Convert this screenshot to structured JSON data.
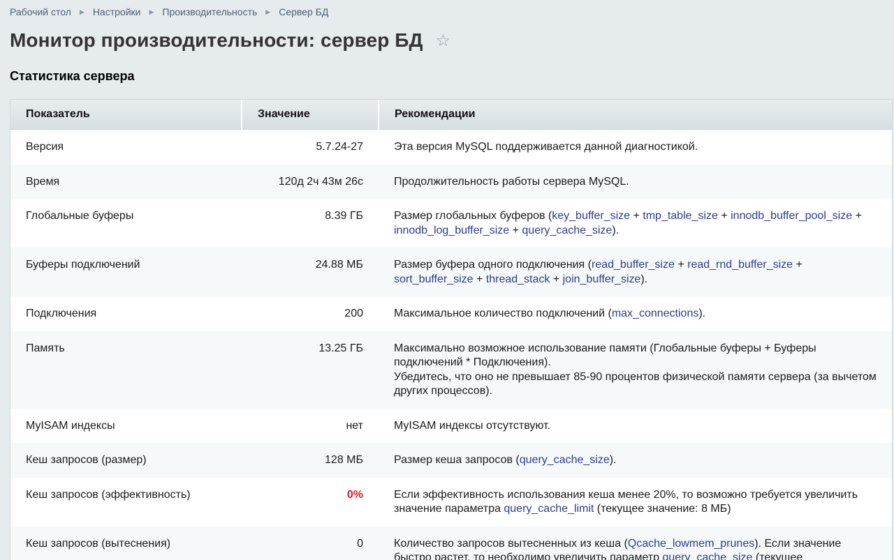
{
  "breadcrumb": {
    "items": [
      "Рабочий стол",
      "Настройки",
      "Производительность",
      "Сервер БД"
    ]
  },
  "page": {
    "title": "Монитор производительности: сервер БД",
    "section_title": "Статистика сервера"
  },
  "icons": {
    "favorite": "star-icon",
    "separator": "triangle-right-icon"
  },
  "colors": {
    "background": "#e6ebee",
    "link": "#2c3c8f",
    "warning": "#e01b1b",
    "row_alt": "#f5f9f9"
  },
  "table": {
    "headers": {
      "metric": "Показатель",
      "value": "Значение",
      "recommendation": "Рекомендации"
    },
    "rows": [
      {
        "metric": "Версия",
        "value": "5.7.24-27",
        "rec": [
          {
            "t": "Эта версия MySQL поддерживается данной диагностикой."
          }
        ]
      },
      {
        "metric": "Время",
        "value": "120д 2ч 43м 26с",
        "rec": [
          {
            "t": "Продолжительность работы сервера MySQL."
          }
        ]
      },
      {
        "metric": "Глобальные буферы",
        "value": "8.39 ГБ",
        "rec": [
          {
            "t": "Размер глобальных буферов ("
          },
          {
            "t": "key_buffer_size",
            "link": true
          },
          {
            "t": " + "
          },
          {
            "t": "tmp_table_size",
            "link": true
          },
          {
            "t": " + "
          },
          {
            "t": "innodb_buffer_pool_size",
            "link": true
          },
          {
            "t": " + "
          },
          {
            "t": "innodb_log_buffer_size",
            "link": true
          },
          {
            "t": " + "
          },
          {
            "t": "query_cache_size",
            "link": true
          },
          {
            "t": ")."
          }
        ]
      },
      {
        "metric": "Буферы подключений",
        "value": "24.88 МБ",
        "rec": [
          {
            "t": "Размер буфера одного подключения ("
          },
          {
            "t": "read_buffer_size",
            "link": true
          },
          {
            "t": " + "
          },
          {
            "t": "read_rnd_buffer_size",
            "link": true
          },
          {
            "t": " + "
          },
          {
            "t": "sort_buffer_size",
            "link": true
          },
          {
            "t": " + "
          },
          {
            "t": "thread_stack",
            "link": true
          },
          {
            "t": " + "
          },
          {
            "t": "join_buffer_size",
            "link": true
          },
          {
            "t": ")."
          }
        ]
      },
      {
        "metric": "Подключения",
        "value": "200",
        "rec": [
          {
            "t": "Максимальное количество подключений ("
          },
          {
            "t": "max_connections",
            "link": true
          },
          {
            "t": ")."
          }
        ]
      },
      {
        "metric": "Память",
        "value": "13.25 ГБ",
        "rec": [
          {
            "t": "Максимально возможное использование памяти (Глобальные буферы + Буферы подключений * Подключения)."
          },
          {
            "br": true
          },
          {
            "t": "Убедитесь, что оно не превышает 85-90 процентов физической памяти сервера (за вычетом других процессов)."
          }
        ]
      },
      {
        "metric": "MyISAM индексы",
        "value": "нет",
        "rec": [
          {
            "t": "MyISAM индексы отсутствуют."
          }
        ]
      },
      {
        "metric": "Кеш запросов (размер)",
        "value": "128 МБ",
        "rec": [
          {
            "t": "Размер кеша запросов ("
          },
          {
            "t": "query_cache_size",
            "link": true
          },
          {
            "t": ")."
          }
        ]
      },
      {
        "metric": "Кеш запросов (эффективность)",
        "value": "0%",
        "warning": true,
        "rec": [
          {
            "t": "Если эффективность использования кеша менее 20%, то возможно требуется увеличить значение параметра "
          },
          {
            "t": "query_cache_limit",
            "link": true
          },
          {
            "t": " (текущее значение: 8 МБ)"
          }
        ]
      },
      {
        "metric": "Кеш запросов (вытеснения)",
        "value": "0",
        "rec": [
          {
            "t": "Количество запросов вытесненных из кеша ("
          },
          {
            "t": "Qcache_lowmem_prunes",
            "link": true
          },
          {
            "t": "). Если значение быстро растет, то необходимо увеличить параметр "
          },
          {
            "t": "query_cache_size",
            "link": true
          },
          {
            "t": " (текущее"
          }
        ]
      }
    ]
  }
}
